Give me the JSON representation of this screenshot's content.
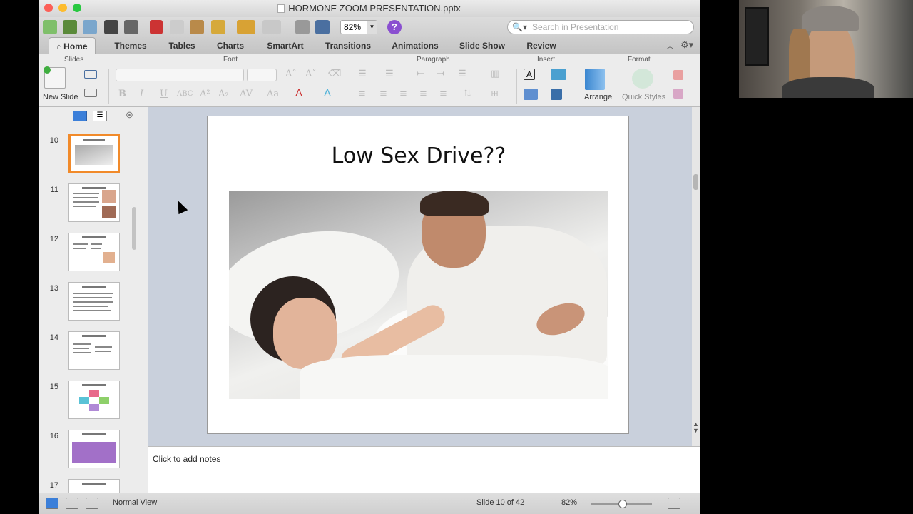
{
  "window": {
    "title": "HORMONE ZOOM PRESENTATION.pptx"
  },
  "toolbar": {
    "zoom": "82%",
    "help_label": "?",
    "search_placeholder": "Search in Presentation"
  },
  "ribbon_tabs": [
    "Home",
    "Themes",
    "Tables",
    "Charts",
    "SmartArt",
    "Transitions",
    "Animations",
    "Slide Show",
    "Review"
  ],
  "ribbon": {
    "groups": [
      "Slides",
      "Font",
      "Paragraph",
      "Insert",
      "Format"
    ],
    "new_slide_label": "New Slide",
    "arrange_label": "Arrange",
    "quick_styles_label": "Quick Styles",
    "font_glyphs": {
      "bold": "B",
      "italic": "I",
      "underline": "U",
      "strike": "ABC"
    }
  },
  "slides_panel": {
    "numbers": [
      "10",
      "11",
      "12",
      "13",
      "14",
      "15",
      "16",
      "17"
    ],
    "selected": "10"
  },
  "slide": {
    "title": "Low Sex Drive??"
  },
  "notes": {
    "placeholder": "Click to add notes"
  },
  "status_bar": {
    "view_name": "Normal View",
    "slide_counter": "Slide 10 of 42",
    "zoom": "82%"
  },
  "colors": {
    "selected_thumb_border": "#f18a2a",
    "help_button": "#8a4fd0",
    "slide_background_area": "#c9d0dc"
  }
}
